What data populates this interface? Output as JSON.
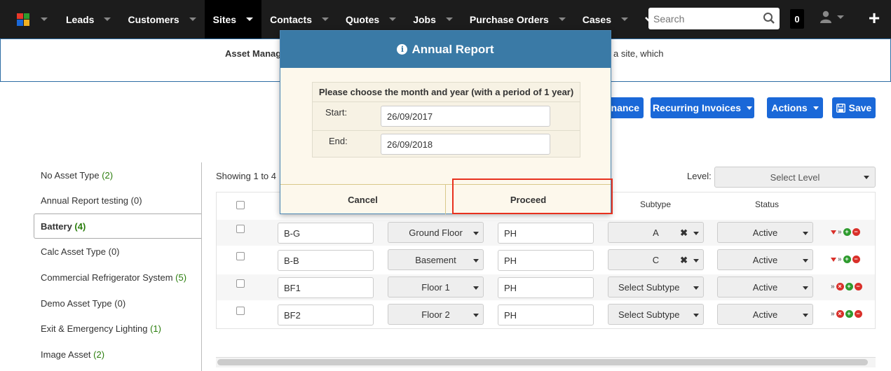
{
  "nav": {
    "items": [
      {
        "label": "Leads"
      },
      {
        "label": "Customers"
      },
      {
        "label": "Sites"
      },
      {
        "label": "Contacts"
      },
      {
        "label": "Quotes"
      },
      {
        "label": "Jobs"
      },
      {
        "label": "Purchase Orders"
      },
      {
        "label": "Cases"
      }
    ],
    "active": "Sites",
    "search_placeholder": "Search",
    "notification_count": "0",
    "logo_colors": [
      "#e8392a",
      "#2e9b2e",
      "#1a68d8",
      "#f0b020"
    ]
  },
  "banner": {
    "text_left": "Asset Manag",
    "text_right": "a site, which"
  },
  "toolbar": {
    "maintenance_label": "enance",
    "recurring_label": "Recurring Invoices",
    "actions_label": "Actions",
    "save_label": "Save"
  },
  "sidebar": {
    "items": [
      {
        "name": "No Asset Type",
        "count": "(2)"
      },
      {
        "name": "Annual Report testing",
        "count": "(0)"
      },
      {
        "name": "Battery",
        "count": "(4)"
      },
      {
        "name": "Calc Asset Type",
        "count": "(0)"
      },
      {
        "name": "Commercial Refrigerator System",
        "count": "(5)"
      },
      {
        "name": "Demo Asset Type",
        "count": "(0)"
      },
      {
        "name": "Exit & Emergency Lighting",
        "count": "(1)"
      },
      {
        "name": "Image Asset",
        "count": "(2)"
      }
    ],
    "active": "Battery"
  },
  "list": {
    "showing": "Showing 1 to 4",
    "level_label": "Level:",
    "level_placeholder": "Select Level",
    "headers": {
      "subtype": "Subtype",
      "status": "Status"
    },
    "rows": [
      {
        "name": "B-G",
        "floor": "Ground Floor",
        "code": "PH",
        "subtype": "A",
        "status": "Active"
      },
      {
        "name": "B-B",
        "floor": "Basement",
        "code": "PH",
        "subtype": "C",
        "status": "Active"
      },
      {
        "name": "BF1",
        "floor": "Floor 1",
        "code": "PH",
        "subtype": "Select Subtype",
        "status": "Active"
      },
      {
        "name": "BF2",
        "floor": "Floor 2",
        "code": "PH",
        "subtype": "Select Subtype",
        "status": "Active"
      }
    ]
  },
  "modal": {
    "title": "Annual Report",
    "instruction": "Please choose the month and year (with a period of 1 year)",
    "start_label": "Start:",
    "start_value": "26/09/2017",
    "end_label": "End:",
    "end_value": "26/09/2018",
    "cancel_label": "Cancel",
    "proceed_label": "Proceed"
  }
}
